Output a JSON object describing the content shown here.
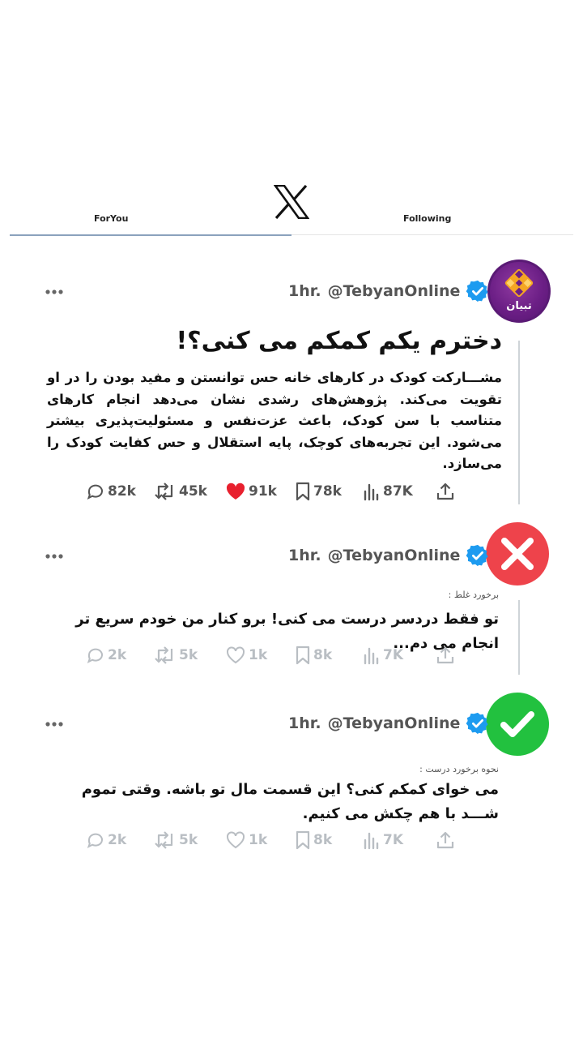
{
  "tabs": {
    "for_you": "ForYou",
    "following": "Following"
  },
  "avatar_logo_text": "تبیان",
  "tweets": [
    {
      "time": "1hr.",
      "handle": "@TebyanOnline",
      "title": "دخترم یکم کمکم می کنی؟!",
      "body": "مشـــارکت کودک در کارهای خانه حس توانستن و مفید بودن را در او تقویت می‌کند. پژوهش‌های رشدی نشان می‌دهد انجام کارهای متناسب با سن کودک، باعث عزت‌نفس و مسئولیت‌پذیری بیشتر می‌شود. این تجربه‌های کوچک، پایه استقلال و حس کفایت کودک را می‌سازد.",
      "stats": {
        "replies": "82k",
        "retweets": "45k",
        "likes": "91k",
        "bookmarks": "78k",
        "views": "87K"
      }
    },
    {
      "time": "1hr.",
      "handle": "@TebyanOnline",
      "caption": "برخورد غلط :",
      "reply": "تو فقط دردسر درست می کنی! برو کنار من خودم سریع تر انجام می دم...",
      "stats": {
        "replies": "2k",
        "retweets": "5k",
        "likes": "1k",
        "bookmarks": "8k",
        "views": "7K"
      }
    },
    {
      "time": "1hr.",
      "handle": "@TebyanOnline",
      "caption": "نحوه برخورد درست :",
      "reply": "می خوای کمکم کنی؟ این قسمت مال تو باشه. وقتی تموم شـــد با هم چکش می کنیم.",
      "stats": {
        "replies": "2k",
        "retweets": "5k",
        "likes": "1k",
        "bookmarks": "8k",
        "views": "7K"
      }
    }
  ],
  "colors": {
    "verified": "#1d9bf0",
    "like_red": "#e8202e",
    "wrong_red": "#ee434b",
    "right_green": "#22c13f",
    "logo_purple": "#6c1f86",
    "logo_orange": "#f5a623"
  }
}
